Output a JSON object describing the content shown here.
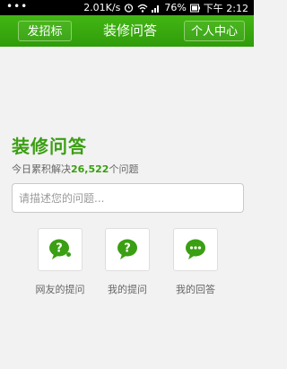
{
  "status_bar": {
    "dots": "•••",
    "speed": "2.01K/s",
    "battery": "76%",
    "time": "下午 2:12"
  },
  "header": {
    "left_button": "发招标",
    "title": "装修问答",
    "right_button": "个人中心"
  },
  "main": {
    "title": "装修问答",
    "stats_prefix": "今日累积解决",
    "stats_count": "26,522",
    "stats_suffix": "个问题",
    "search_placeholder": "请描述您的问题..."
  },
  "actions": [
    {
      "label": "网友的提问",
      "icon": "question-bubble-icon"
    },
    {
      "label": "我的提问",
      "icon": "question-bubble-icon"
    },
    {
      "label": "我的回答",
      "icon": "ellipsis-bubble-icon"
    }
  ],
  "colors": {
    "accent": "#3a9f12",
    "header_green": "#43b614",
    "background": "#f2f2f2"
  }
}
